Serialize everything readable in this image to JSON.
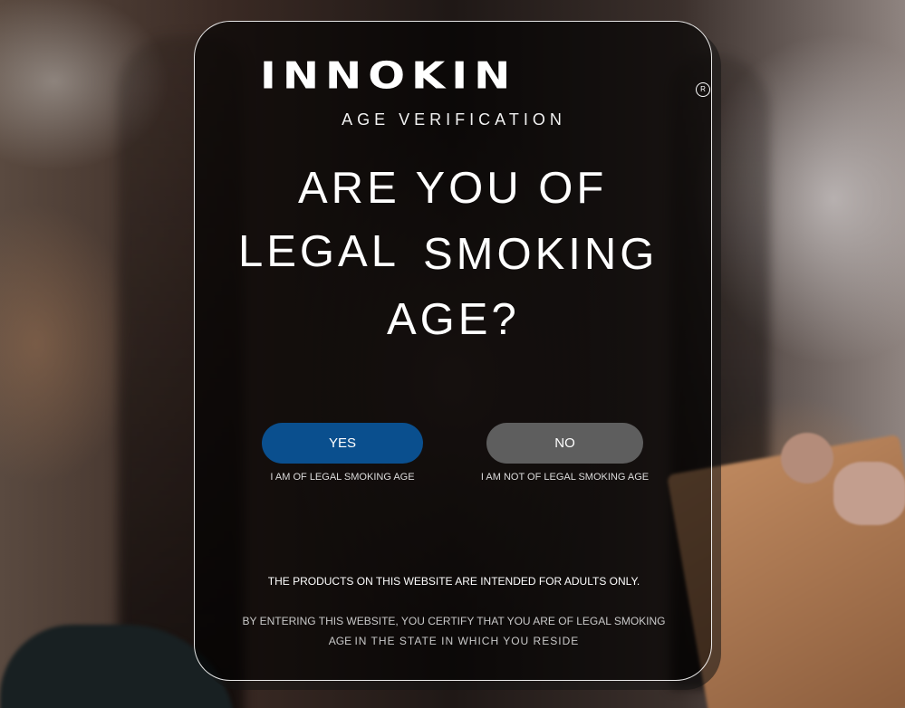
{
  "logo": {
    "text": "INNOKIN",
    "registered_mark": "R"
  },
  "modal": {
    "subtitle": "AGE VERIFICATION",
    "headline": {
      "line1": "ARE YOU OF",
      "line2a": "LEGAL",
      "line2b": "SMOKING",
      "line3": "AGE?"
    },
    "yes_button": "YES",
    "yes_caption": "I AM OF LEGAL SMOKING AGE",
    "no_button": "NO",
    "no_caption": "I AM NOT OF LEGAL SMOKING AGE",
    "notice": "THE PRODUCTS ON THIS WEBSITE ARE INTENDED FOR ADULTS ONLY.",
    "certify_main": "BY ENTERING THIS WEBSITE, YOU CERTIFY THAT YOU ARE OF LEGAL SMOKING AGE",
    "certify_tail": "IN THE STATE IN WHICH YOU RESIDE"
  },
  "colors": {
    "yes_button": "#0a4f8e",
    "no_button": "#5e5e5e",
    "text": "#ffffff"
  }
}
